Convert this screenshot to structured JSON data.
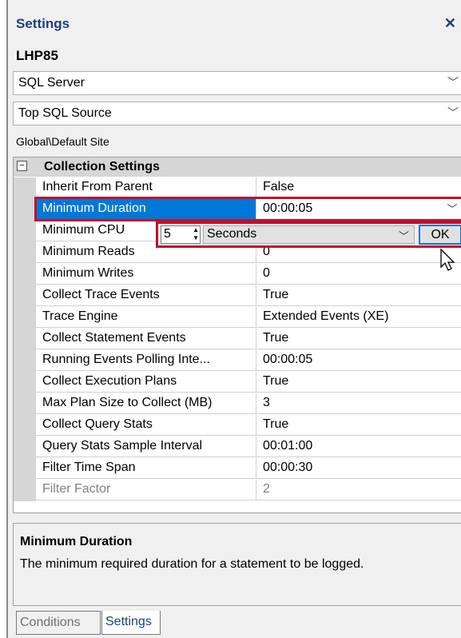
{
  "panel": {
    "title": "Settings",
    "close_glyph": "✕",
    "server_name": "LHP85"
  },
  "combos": {
    "server_type": "SQL Server",
    "source": "Top SQL Source",
    "arrow": "﹀"
  },
  "site_path": "Global\\Default Site",
  "grid": {
    "category": "Collection Settings",
    "rows": [
      {
        "name": "Inherit From Parent",
        "value": "False"
      },
      {
        "name": "Minimum Duration",
        "value": "00:00:05"
      },
      {
        "name": "Minimum CPU",
        "value": ""
      },
      {
        "name": "Minimum Reads",
        "value": "0"
      },
      {
        "name": "Minimum Writes",
        "value": "0"
      },
      {
        "name": "Collect Trace Events",
        "value": "True"
      },
      {
        "name": "Trace Engine",
        "value": "Extended Events (XE)"
      },
      {
        "name": "Collect Statement Events",
        "value": "True"
      },
      {
        "name": "Running Events Polling Inte...",
        "value": "00:00:05"
      },
      {
        "name": "Collect Execution Plans",
        "value": "True"
      },
      {
        "name": "Max Plan Size to Collect (MB)",
        "value": "3"
      },
      {
        "name": "Collect Query Stats",
        "value": "True"
      },
      {
        "name": "Query Stats Sample Interval",
        "value": "00:01:00"
      },
      {
        "name": "Filter Time Span",
        "value": "00:00:30"
      },
      {
        "name": "Filter Factor",
        "value": "2"
      }
    ]
  },
  "editor": {
    "number": "5",
    "units": "Seconds",
    "ok_label": "OK"
  },
  "description": {
    "heading": "Minimum Duration",
    "text": "The minimum required duration for a statement to be logged."
  },
  "tabs": {
    "conditions": "Conditions",
    "settings": "Settings"
  },
  "colors": {
    "accent": "#0078d7",
    "highlight": "#c0102c",
    "title": "#1e3f7a"
  }
}
